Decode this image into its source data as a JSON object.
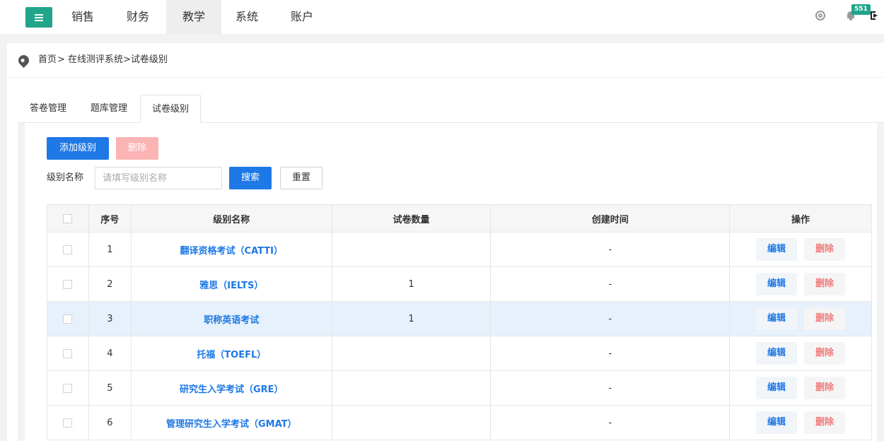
{
  "nav": {
    "items": [
      {
        "label": "销售",
        "active": false
      },
      {
        "label": "财务",
        "active": false
      },
      {
        "label": "教学",
        "active": true
      },
      {
        "label": "系统",
        "active": false
      },
      {
        "label": "账户",
        "active": false
      }
    ],
    "badge_count": "551"
  },
  "breadcrumb": {
    "home": "首页",
    "path": "> 在线测评系统>试卷级别"
  },
  "tabs": [
    {
      "label": "答卷管理",
      "active": false
    },
    {
      "label": "题库管理",
      "active": false
    },
    {
      "label": "试卷级别",
      "active": true
    }
  ],
  "toolbar": {
    "add_label": "添加级别",
    "delete_label": "删除"
  },
  "filter": {
    "label": "级别名称",
    "placeholder": "请填写级别名称",
    "search_label": "搜索",
    "reset_label": "重置"
  },
  "table": {
    "headers": [
      "",
      "序号",
      "级别名称",
      "试卷数量",
      "创建时间",
      "操作"
    ],
    "rows": [
      {
        "index": "1",
        "name": "翻译资格考试（CATTI）",
        "count": "",
        "created": "-",
        "highlight": false
      },
      {
        "index": "2",
        "name": "雅思（IELTS）",
        "count": "1",
        "created": "-",
        "highlight": false
      },
      {
        "index": "3",
        "name": "职称英语考试",
        "count": "1",
        "created": "-",
        "highlight": true
      },
      {
        "index": "4",
        "name": "托福（TOEFL）",
        "count": "",
        "created": "-",
        "highlight": false
      },
      {
        "index": "5",
        "name": "研究生入学考试（GRE）",
        "count": "",
        "created": "-",
        "highlight": false
      },
      {
        "index": "6",
        "name": "管理研究生入学考试（GMAT）",
        "count": "",
        "created": "-",
        "highlight": false
      }
    ],
    "edit_label": "编辑",
    "delete_label": "删除"
  },
  "colors": {
    "accent": "#20a58a",
    "primary": "#1e78e6",
    "danger_light": "#fbb3b3",
    "row_highlight": "#e6f1fb"
  }
}
